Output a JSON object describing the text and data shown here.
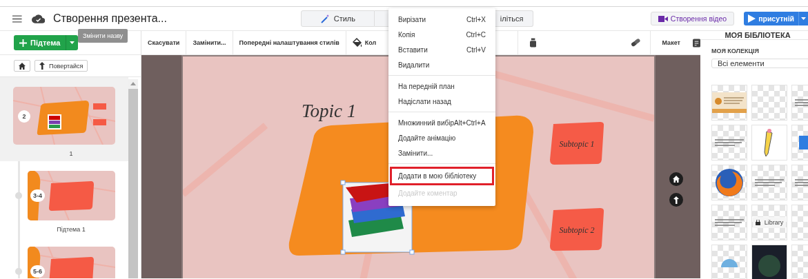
{
  "header": {
    "title": "Створення презента...",
    "tooltip": "Змінити назву",
    "style_button": "Стиль",
    "share_button": "іліться",
    "video_button": "Створення відео",
    "present_button": "присутній"
  },
  "toolbar": {
    "items": [
      {
        "kind": "text",
        "label": "Скасувати"
      },
      {
        "kind": "text",
        "label": "Замінити..."
      },
      {
        "kind": "text",
        "label": "Попередні налаштування стилів"
      },
      {
        "kind": "bucket",
        "label": "Кол"
      }
    ],
    "layout_button": "Макет"
  },
  "sidebar": {
    "add_button": "Підтема",
    "back_button": "Повертайся",
    "slides": [
      {
        "kind": "topic",
        "badge": "2",
        "label": "1",
        "selected": true
      },
      {
        "kind": "subtopic",
        "badge": "3-4",
        "label": "Підтема 1",
        "selected": false
      },
      {
        "kind": "subtopic",
        "badge": "5-6",
        "selected": false
      }
    ]
  },
  "canvas": {
    "topic": "Topic 1",
    "subtopics": [
      "Subtopic 1",
      "Subtopic 2"
    ],
    "image_selected": true
  },
  "context_menu": {
    "groups": [
      [
        {
          "label": "Вирізати",
          "shortcut": "Ctrl+X",
          "highlighted": false,
          "disabled": false
        },
        {
          "label": "Копія",
          "shortcut": "Ctrl+C",
          "highlighted": false,
          "disabled": false
        },
        {
          "label": "Вставити",
          "shortcut": "Ctrl+V",
          "highlighted": false,
          "disabled": false
        },
        {
          "label": "Видалити",
          "highlighted": false,
          "disabled": false
        }
      ],
      [
        {
          "label": "На передній план",
          "highlighted": false,
          "disabled": false
        },
        {
          "label": "Надіслати назад",
          "highlighted": false,
          "disabled": false
        }
      ],
      [
        {
          "label": "Множинний вибір",
          "shortcut": "Alt+Ctrl+A",
          "inline": true,
          "highlighted": false,
          "disabled": false
        },
        {
          "label": "Додайте анімацію",
          "highlighted": false,
          "disabled": false
        },
        {
          "label": "Замінити...",
          "highlighted": false,
          "disabled": false
        }
      ],
      [
        {
          "label": "Додати в мою бібліотеку",
          "highlighted": true,
          "disabled": false
        },
        {
          "label": "Додайте коментар",
          "highlighted": false,
          "disabled": true
        }
      ]
    ]
  },
  "library": {
    "title": "МОЯ БІБЛІОТЕКА",
    "collection_label": "МОЯ КОЛЕКЦІЯ",
    "filter": "Всі елементи",
    "items": [
      {
        "kind": "certificate"
      },
      {
        "kind": "blank"
      },
      {
        "kind": "text"
      },
      {
        "kind": "text"
      },
      {
        "kind": "pencil"
      },
      {
        "kind": "blue-button"
      },
      {
        "kind": "firefox"
      },
      {
        "kind": "text"
      },
      {
        "kind": "text"
      },
      {
        "kind": "text"
      },
      {
        "kind": "library",
        "label": "Library"
      },
      {
        "kind": "blank"
      },
      {
        "kind": "globe"
      },
      {
        "kind": "dark"
      },
      {
        "kind": "blank"
      }
    ]
  }
}
